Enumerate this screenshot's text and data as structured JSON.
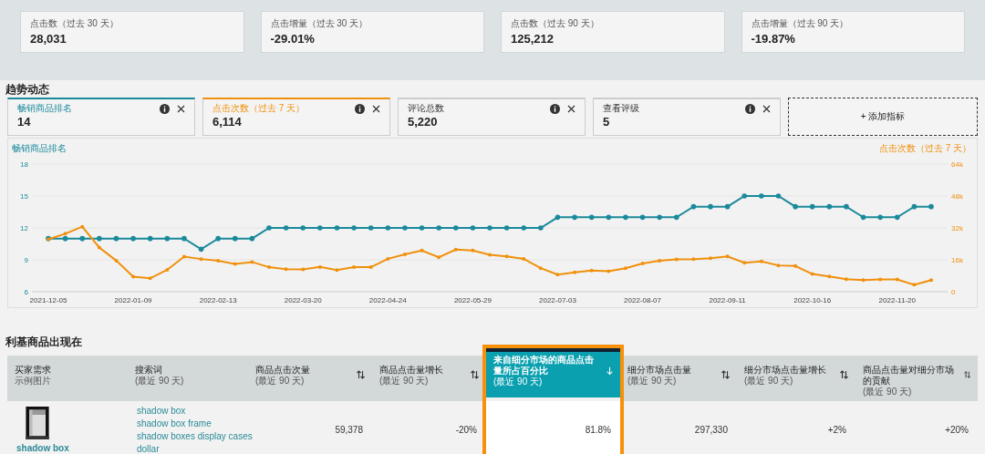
{
  "summary_cards": [
    {
      "label": "点击数（过去 30 天）",
      "value": "28,031"
    },
    {
      "label": "点击增量（过去 30 天）",
      "value": "-29.01%"
    },
    {
      "label": "点击数（过去 90 天）",
      "value": "125,212"
    },
    {
      "label": "点击增量（过去 90 天）",
      "value": "-19.87%"
    }
  ],
  "trends": {
    "title": "趋势动态",
    "metrics": [
      {
        "label": "畅销商品排名",
        "value": "14",
        "selected": true,
        "color": "#1a8a9a"
      },
      {
        "label": "点击次数（过去 7 天）",
        "value": "6,114",
        "selected": true,
        "color": "#f0900c"
      },
      {
        "label": "评论总数",
        "value": "5,220",
        "selected": false
      },
      {
        "label": "查看评级",
        "value": "5",
        "selected": false
      }
    ],
    "add_metric": "+ 添加指标",
    "chart_data": {
      "type": "line",
      "grid": true,
      "ylim": [
        6,
        18
      ],
      "yticks": [
        6,
        9,
        12,
        15,
        18
      ],
      "y2lim": [
        0,
        64000
      ],
      "y2ticks": [
        {
          "value": 0,
          "label": "0"
        },
        {
          "value": 16000,
          "label": "16k"
        },
        {
          "value": 32000,
          "label": "32k"
        },
        {
          "value": 48000,
          "label": "48k"
        },
        {
          "value": 64000,
          "label": "64k"
        }
      ],
      "categories": [
        "2021-12-05",
        null,
        null,
        null,
        null,
        "2022-01-09",
        null,
        null,
        null,
        null,
        "2022-02-13",
        null,
        null,
        null,
        null,
        "2022-03-20",
        null,
        null,
        null,
        null,
        "2022-04-24",
        null,
        null,
        null,
        null,
        "2022-05-29",
        null,
        null,
        null,
        null,
        "2022-07-03",
        null,
        null,
        null,
        null,
        "2022-08-07",
        null,
        null,
        null,
        null,
        "2022-09-11",
        null,
        null,
        null,
        null,
        "2022-10-16",
        null,
        null,
        null,
        null,
        "2022-11-20",
        null,
        null
      ],
      "series": [
        {
          "name": "畅销商品排名",
          "color": "#1a8a9a",
          "values": [
            11,
            11,
            11,
            11,
            11,
            11,
            11,
            11,
            11,
            10,
            11,
            11,
            11,
            12,
            12,
            12,
            12,
            12,
            12,
            12,
            12,
            12,
            12,
            12,
            12,
            12,
            12,
            12,
            12,
            12,
            13,
            13,
            13,
            13,
            13,
            13,
            13,
            13,
            14,
            14,
            14,
            15,
            15,
            15,
            14,
            14,
            14,
            14,
            13,
            13,
            13,
            14,
            14
          ]
        },
        {
          "name": "点击次数（过去 7 天）",
          "color": "#f0900c",
          "axis": "y2",
          "values": [
            26300,
            29100,
            32600,
            22200,
            15600,
            7500,
            6700,
            11000,
            17600,
            16400,
            15500,
            13900,
            14900,
            12300,
            11300,
            11200,
            12400,
            10900,
            12300,
            12300,
            16500,
            18700,
            20700,
            17300,
            21100,
            20700,
            18500,
            17700,
            16500,
            11800,
            8600,
            9700,
            10600,
            10300,
            11800,
            14200,
            15500,
            16200,
            16300,
            16800,
            17700,
            14500,
            15200,
            13200,
            12900,
            8900,
            7700,
            6300,
            5800,
            6200,
            6200,
            3500,
            5800
          ]
        }
      ]
    }
  },
  "niche": {
    "title": "利基商品出现在",
    "columns": [
      {
        "title": "买家需求",
        "subtitle": "示例图片",
        "sortable": false,
        "selected": false
      },
      {
        "title": "搜索词",
        "subtitle": "(最近 90 天)",
        "sortable": false,
        "selected": false
      },
      {
        "title": "商品点击次量",
        "subtitle": "(最近 90 天)",
        "sortable": true,
        "selected": false
      },
      {
        "title": "商品点击量增长",
        "subtitle": "(最近 90 天)",
        "sortable": true,
        "selected": false
      },
      {
        "title": "来自细分市场的商品点击量所占百分比",
        "subtitle": "(最近 90 天)",
        "sortable": true,
        "selected": true
      },
      {
        "title": "细分市场点击量",
        "subtitle": "(最近 90 天)",
        "sortable": true,
        "selected": false
      },
      {
        "title": "细分市场点击量增长",
        "subtitle": "(最近 90 天)",
        "sortable": true,
        "selected": false
      },
      {
        "title": "商品点击量对细分市场的贡献",
        "subtitle": "(最近 90 天)",
        "sortable": true,
        "selected": false
      }
    ],
    "rows": [
      {
        "product": {
          "kind": "picture",
          "name": "shadow box"
        },
        "search_terms": [
          "shadow box",
          "shadow box frame",
          "shadow boxes display cases",
          "dollar"
        ],
        "values": [
          "59,378",
          "-20%",
          "81.8%",
          "297,330",
          "+2%",
          "+20%"
        ]
      }
    ]
  }
}
